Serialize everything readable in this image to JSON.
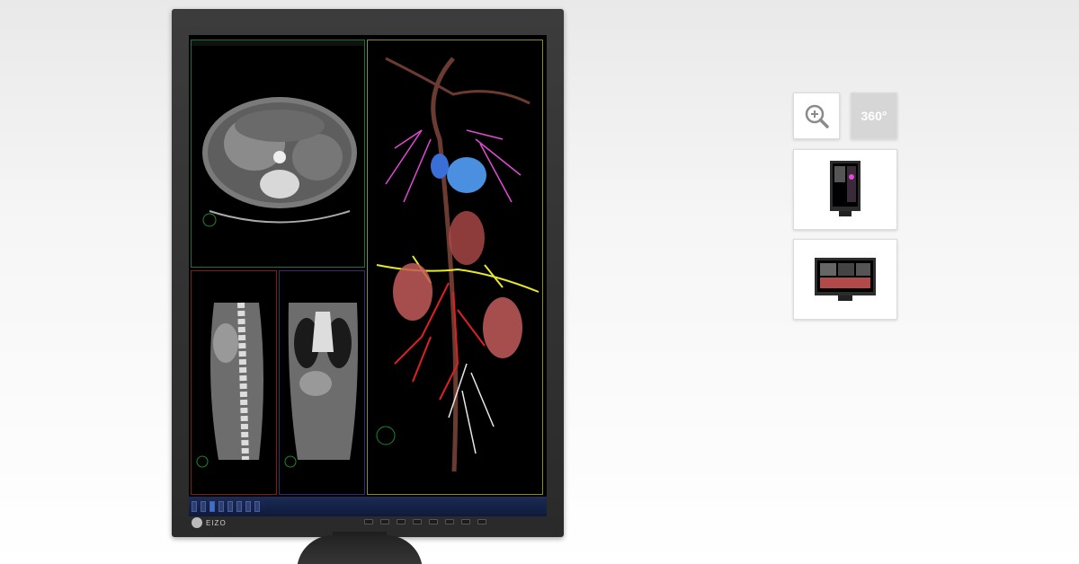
{
  "monitor": {
    "brand": "EIZO",
    "taskbar_items": [
      "",
      "",
      "",
      "",
      "",
      "",
      "",
      "",
      "",
      "",
      ""
    ]
  },
  "controls": {
    "zoom_icon": "zoom-in-icon",
    "rotate_label": "360°"
  },
  "thumbnails": [
    {
      "icon": "portrait-monitor-thumbnail"
    },
    {
      "icon": "landscape-monitor-thumbnail"
    }
  ]
}
